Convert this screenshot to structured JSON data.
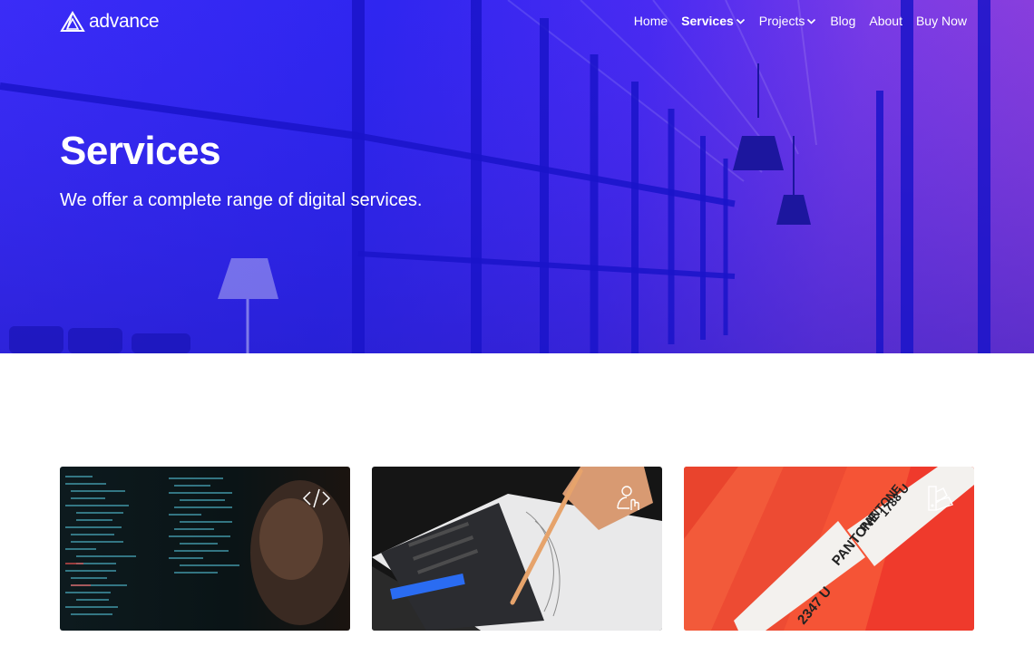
{
  "brand": {
    "name": "advance"
  },
  "nav": {
    "items": [
      {
        "label": "Home",
        "active": false,
        "dropdown": false
      },
      {
        "label": "Services",
        "active": true,
        "dropdown": true
      },
      {
        "label": "Projects",
        "active": false,
        "dropdown": true
      },
      {
        "label": "Blog",
        "active": false,
        "dropdown": false
      },
      {
        "label": "About",
        "active": false,
        "dropdown": false
      },
      {
        "label": "Buy Now",
        "active": false,
        "dropdown": false
      }
    ]
  },
  "hero": {
    "title": "Services",
    "subtitle": "We offer a complete range of digital services."
  },
  "cards": [
    {
      "icon": "code-icon"
    },
    {
      "icon": "user-touch-icon"
    },
    {
      "icon": "color-swatch-icon",
      "swatch_text": [
        "PANTONE",
        "2347 U",
        "PANTONE",
        "1788 U"
      ]
    }
  ],
  "colors": {
    "hero_blue": "#3b2cf7",
    "hero_purple": "#8e3fd9",
    "swatch_red": "#f2452f"
  }
}
